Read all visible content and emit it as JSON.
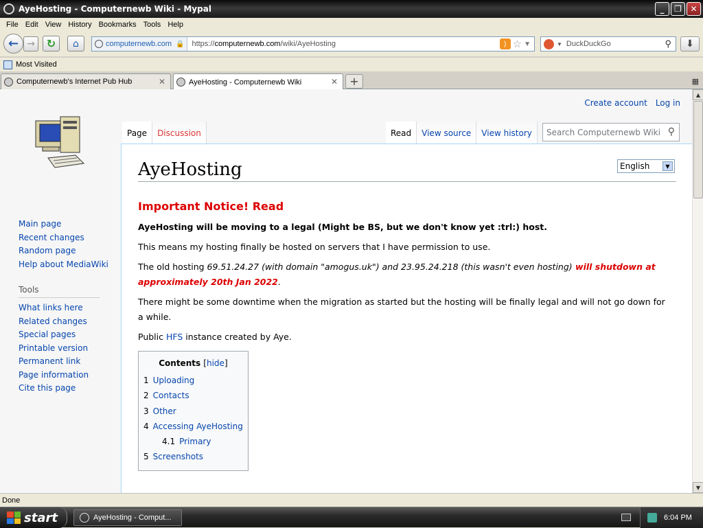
{
  "window": {
    "title": "AyeHosting - Computernewb Wiki - Mypal",
    "minimize": "_",
    "maximize": "❐",
    "close": "✕"
  },
  "menu": [
    "File",
    "Edit",
    "View",
    "History",
    "Bookmarks",
    "Tools",
    "Help"
  ],
  "navbar": {
    "identity_domain": "computernewb.com",
    "url_prefix": "https://",
    "url_host": "computernewb.com",
    "url_path": "/wiki/AyeHosting",
    "search_engine": "DuckDuckGo"
  },
  "bookmarks": {
    "most_visited": "Most Visited"
  },
  "tabs": [
    {
      "label": "Computernewb's Internet Pub Hub",
      "active": false
    },
    {
      "label": "AyeHosting - Computernewb Wiki",
      "active": true
    }
  ],
  "wiki": {
    "personal": {
      "create_account": "Create account",
      "log_in": "Log in"
    },
    "nav_links": [
      "Main page",
      "Recent changes",
      "Random page",
      "Help about MediaWiki"
    ],
    "tools_heading": "Tools",
    "tools_links": [
      "What links here",
      "Related changes",
      "Special pages",
      "Printable version",
      "Permanent link",
      "Page information",
      "Cite this page"
    ],
    "view_tabs_left": {
      "page": "Page",
      "discussion": "Discussion"
    },
    "view_tabs_right": {
      "read": "Read",
      "view_source": "View source",
      "view_history": "View history"
    },
    "search_placeholder": "Search Computernewb Wiki",
    "language": "English",
    "page_title": "AyeHosting",
    "notice_title": "Important Notice! Read",
    "notice_bold": "AyeHosting will be moving to a legal (Might be BS, but we don't know yet :trl:) host.",
    "para1": "This means my hosting finally be hosted on servers that I have permission to use.",
    "para2_start": "The old hosting ",
    "para2_italic": "69.51.24.27 (with domain \"amogus.uk\") and 23.95.24.218 (this wasn't even hosting)",
    "para2_red": " will shutdown at approximately 20th Jan 2022",
    "para2_end": ".",
    "para3": "There might be some downtime when the migration as started but the hosting will be finally legal and will not go down for a while.",
    "para4_start": "Public ",
    "para4_link": "HFS",
    "para4_end": " instance created by Aye.",
    "toc": {
      "title": "Contents",
      "hide_open": "[",
      "hide_label": "hide",
      "hide_close": "]",
      "items": [
        {
          "number": "1",
          "text": "Uploading"
        },
        {
          "number": "2",
          "text": "Contacts"
        },
        {
          "number": "3",
          "text": "Other"
        },
        {
          "number": "4",
          "text": "Accessing AyeHosting"
        },
        {
          "number": "4.1",
          "text": "Primary"
        },
        {
          "number": "5",
          "text": "Screenshots"
        }
      ]
    }
  },
  "status": {
    "text": "Done"
  },
  "taskbar": {
    "start": "start",
    "task": "AyeHosting - Comput...",
    "clock": "6:04 PM"
  }
}
